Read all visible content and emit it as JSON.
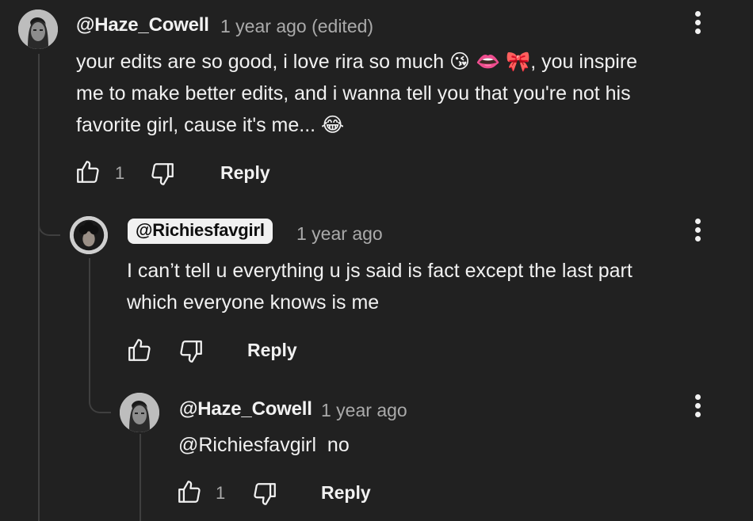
{
  "comments": [
    {
      "author": "@Haze_Cowell",
      "time": "1 year ago (edited)",
      "lines": [
        "your edits are so good, i love rira so much 😘 👄 🎀, you inspire",
        "me to make better edits, and i wanna tell you that you're not his",
        "favorite girl, cause it's me... 😂"
      ],
      "likes": "1",
      "reply_label": "Reply"
    },
    {
      "author": "@Richiesfavgirl",
      "time": "1 year ago",
      "lines": [
        "I can’t tell u everything u js said is fact except the last part",
        "which everyone knows is me"
      ],
      "likes": "",
      "reply_label": "Reply"
    },
    {
      "author": "@Haze_Cowell",
      "time": "1 year ago",
      "lines": [
        "@Richiesfavgirl  no"
      ],
      "likes": "1",
      "reply_label": "Reply"
    }
  ],
  "icons": {
    "like": "thumbs-up-icon",
    "dislike": "thumbs-down-icon",
    "menu": "more-vertical-icon"
  },
  "colors": {
    "background": "#212121",
    "text": "#f1f1f1",
    "secondary": "#aaaaaa",
    "thread_line": "#3f3f3f"
  }
}
